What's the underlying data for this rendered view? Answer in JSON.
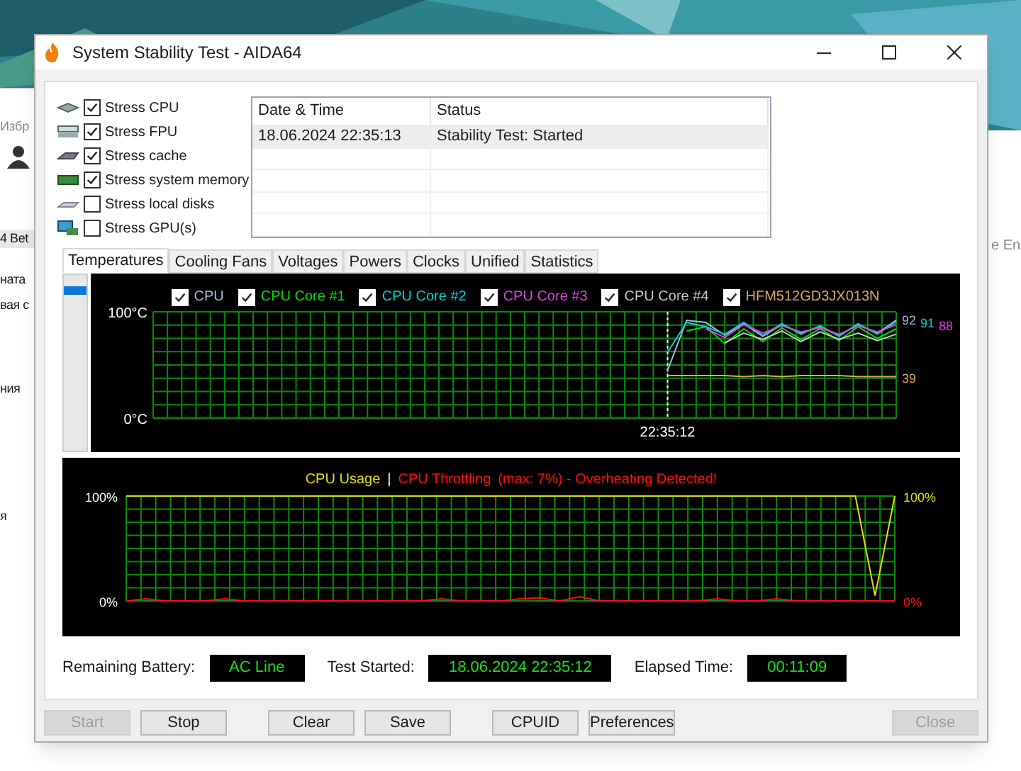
{
  "background_window": {
    "left_texts": [
      "Избр",
      "4 Bet",
      "ната",
      "вая с",
      "ния",
      "я"
    ],
    "right_texts": [
      "e En"
    ]
  },
  "window": {
    "title": "System Stability Test - AIDA64"
  },
  "stress_options": [
    {
      "label": "Stress CPU",
      "checked": true
    },
    {
      "label": "Stress FPU",
      "checked": true
    },
    {
      "label": "Stress cache",
      "checked": true
    },
    {
      "label": "Stress system memory",
      "checked": true
    },
    {
      "label": "Stress local disks",
      "checked": false
    },
    {
      "label": "Stress GPU(s)",
      "checked": false
    }
  ],
  "log": {
    "columns": [
      "Date & Time",
      "Status"
    ],
    "rows": [
      {
        "cells": [
          "18.06.2024 22:35:13",
          "Stability Test: Started"
        ],
        "selected": true
      }
    ]
  },
  "tabs": [
    {
      "label": "Temperatures",
      "selected": true
    },
    {
      "label": "Cooling Fans",
      "selected": false
    },
    {
      "label": "Voltages",
      "selected": false
    },
    {
      "label": "Powers",
      "selected": false
    },
    {
      "label": "Clocks",
      "selected": false
    },
    {
      "label": "Unified",
      "selected": false
    },
    {
      "label": "Statistics",
      "selected": false
    }
  ],
  "temperature_chart": {
    "start_label": "22:35:12",
    "legend": [
      {
        "checked": true
      },
      {
        "checked": true
      },
      {
        "checked": true
      },
      {
        "checked": true
      },
      {
        "checked": true
      },
      {
        "checked": true
      }
    ],
    "end_labels": [
      {
        "text": "92",
        "color": "#a8b8e0"
      },
      {
        "text": "91",
        "color": "#00d0d0"
      },
      {
        "text": "88",
        "color": "#e040e0"
      },
      {
        "text": "39",
        "color": "#d8a860"
      }
    ],
    "chart_data": {
      "type": "line",
      "grid": true,
      "yticks": [
        {
          "value": 0,
          "label": "0°C"
        },
        {
          "value": 100,
          "label": "100°C"
        }
      ],
      "ylim": [
        0,
        100
      ],
      "series": [
        {
          "name": "CPU",
          "color": "#a8b8e0",
          "values": [
            null,
            null,
            null,
            null,
            null,
            null,
            null,
            null,
            null,
            null,
            null,
            null,
            null,
            null,
            null,
            null,
            null,
            null,
            null,
            null,
            null,
            null,
            null,
            null,
            null,
            null,
            null,
            45,
            92,
            90,
            78,
            89,
            77,
            88,
            80,
            86,
            78,
            88,
            80,
            92
          ]
        },
        {
          "name": "CPU Core #1",
          "color": "#00e000",
          "values": [
            null,
            null,
            null,
            null,
            null,
            null,
            null,
            null,
            null,
            null,
            null,
            null,
            null,
            null,
            null,
            null,
            null,
            null,
            null,
            null,
            null,
            null,
            null,
            null,
            null,
            null,
            null,
            null,
            82,
            86,
            70,
            84,
            72,
            85,
            74,
            84,
            73,
            86,
            75,
            84
          ]
        },
        {
          "name": "CPU Core #2",
          "color": "#00d0d0",
          "values": [
            null,
            null,
            null,
            null,
            null,
            null,
            null,
            null,
            null,
            null,
            null,
            null,
            null,
            null,
            null,
            null,
            null,
            null,
            null,
            null,
            null,
            null,
            null,
            null,
            null,
            null,
            null,
            62,
            90,
            86,
            79,
            90,
            78,
            89,
            79,
            87,
            77,
            89,
            79,
            91
          ]
        },
        {
          "name": "CPU Core #3",
          "color": "#e040e0",
          "values": [
            null,
            null,
            null,
            null,
            null,
            null,
            null,
            null,
            null,
            null,
            null,
            null,
            null,
            null,
            null,
            null,
            null,
            null,
            null,
            null,
            null,
            null,
            null,
            null,
            null,
            null,
            null,
            null,
            null,
            84,
            76,
            88,
            80,
            87,
            81,
            85,
            79,
            87,
            81,
            88
          ]
        },
        {
          "name": "CPU Core #4",
          "color": "#c8c8c8",
          "values": [
            null,
            null,
            null,
            null,
            null,
            null,
            null,
            null,
            null,
            null,
            null,
            null,
            null,
            null,
            null,
            null,
            null,
            null,
            null,
            null,
            null,
            null,
            null,
            null,
            null,
            null,
            null,
            null,
            null,
            null,
            71,
            80,
            74,
            82,
            72,
            81,
            74,
            80,
            73,
            79
          ]
        },
        {
          "name": "HFM512GD3JX013N",
          "color": "#d8a860",
          "values": [
            null,
            null,
            null,
            null,
            null,
            null,
            null,
            null,
            null,
            null,
            null,
            null,
            null,
            null,
            null,
            null,
            null,
            null,
            null,
            null,
            null,
            null,
            null,
            null,
            null,
            null,
            null,
            40,
            40,
            40,
            40,
            39,
            40,
            39,
            40,
            40,
            40,
            39,
            39,
            39
          ]
        }
      ]
    }
  },
  "usage_chart": {
    "separator": "|",
    "note": "(max: 7%) - Overheating Detected!",
    "end_labels": [
      {
        "text": "100%",
        "color": "#e0e000"
      },
      {
        "text": "0%",
        "color": "#ff1010"
      }
    ],
    "chart_data": {
      "type": "line",
      "grid": true,
      "yticks": [
        {
          "value": 0,
          "label": "0%"
        },
        {
          "value": 100,
          "label": "100%"
        }
      ],
      "ylim": [
        0,
        100
      ],
      "series": [
        {
          "name": "CPU Usage",
          "color": "#e0e000",
          "values": [
            100,
            100,
            100,
            100,
            100,
            100,
            100,
            100,
            100,
            100,
            100,
            100,
            100,
            100,
            100,
            100,
            100,
            100,
            100,
            100,
            100,
            100,
            100,
            100,
            100,
            100,
            100,
            100,
            100,
            100,
            100,
            100,
            100,
            100,
            100,
            100,
            100,
            100,
            5,
            100
          ]
        },
        {
          "name": "CPU Throttling",
          "color": "#ff1010",
          "values": [
            0,
            2,
            0,
            0,
            0,
            2,
            0,
            0,
            0,
            0,
            0,
            0,
            0,
            0,
            0,
            0,
            2,
            0,
            0,
            0,
            2,
            3,
            0,
            4,
            0,
            0,
            0,
            0,
            0,
            0,
            2,
            0,
            0,
            2,
            0,
            0,
            0,
            0,
            0,
            0
          ]
        }
      ]
    }
  },
  "status": [
    {
      "label": "Remaining Battery:",
      "value": "AC Line"
    },
    {
      "label": "Test Started:",
      "value": "18.06.2024 22:35:12"
    },
    {
      "label": "Elapsed Time:",
      "value": "00:11:09"
    }
  ],
  "buttons": [
    {
      "label": "Start",
      "disabled": true
    },
    {
      "label": "Stop",
      "disabled": false
    },
    {
      "label": "Clear",
      "disabled": false
    },
    {
      "label": "Save",
      "disabled": false
    },
    {
      "label": "CPUID",
      "disabled": false
    },
    {
      "label": "Preferences",
      "disabled": false
    },
    {
      "label": "Close",
      "disabled": true
    }
  ]
}
